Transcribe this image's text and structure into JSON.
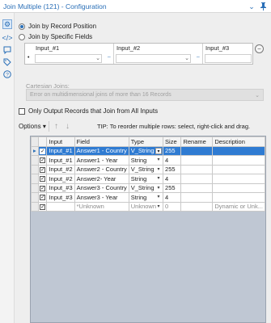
{
  "titlebar": {
    "title": "Join Multiple (121) - Configuration",
    "icons": [
      "chevron-down-icon",
      "pin-icon"
    ]
  },
  "leftbar": {
    "icons": [
      "gear-icon",
      "xml-icon",
      "annotation-icon",
      "tag-icon",
      "help-icon"
    ]
  },
  "join_mode": {
    "options": [
      {
        "label": "Join by Record Position",
        "selected": true
      },
      {
        "label": "Join by Specific Fields",
        "selected": false
      }
    ]
  },
  "join_grid": {
    "columns": [
      {
        "header": "Input_#1"
      },
      {
        "header": "Input_#2"
      },
      {
        "header": "Input_#3"
      }
    ]
  },
  "cartesian": {
    "label": "Cartesian Joins:",
    "value": "Error on multidimensional joins of more than 16 Records"
  },
  "only_output": {
    "label": "Only Output Records that Join from All Inputs",
    "checked": false
  },
  "toolbar": {
    "options_label": "Options",
    "tip": "TIP: To reorder multiple rows: select, right-click and drag."
  },
  "fields_table": {
    "headers": [
      "Input",
      "Field",
      "Type",
      "Size",
      "Rename",
      "Description"
    ],
    "rows": [
      {
        "checked": true,
        "input": "Input_#1",
        "field": "Answer1 - Country",
        "type": "V_String",
        "size": "255",
        "rename": "",
        "description": "",
        "selected": true
      },
      {
        "checked": true,
        "input": "Input_#1",
        "field": "Answer1 - Year",
        "type": "String",
        "size": "4",
        "rename": "",
        "description": ""
      },
      {
        "checked": true,
        "input": "Input_#2",
        "field": "Answer2 - Country",
        "type": "V_String",
        "size": "255",
        "rename": "",
        "description": ""
      },
      {
        "checked": true,
        "input": "Input_#2",
        "field": "Answer2- Year",
        "type": "String",
        "size": "4",
        "rename": "",
        "description": ""
      },
      {
        "checked": true,
        "input": "Input_#3",
        "field": "Answer3 - Country",
        "type": "V_String",
        "size": "255",
        "rename": "",
        "description": ""
      },
      {
        "checked": true,
        "input": "Input_#3",
        "field": "Answer3 - Year",
        "type": "String",
        "size": "4",
        "rename": "",
        "description": ""
      },
      {
        "checked": true,
        "input": "",
        "field": "*Unknown",
        "type": "Unknown",
        "size": "0",
        "rename": "",
        "description": "Dynamic or Unk...",
        "unknown": true
      }
    ]
  }
}
